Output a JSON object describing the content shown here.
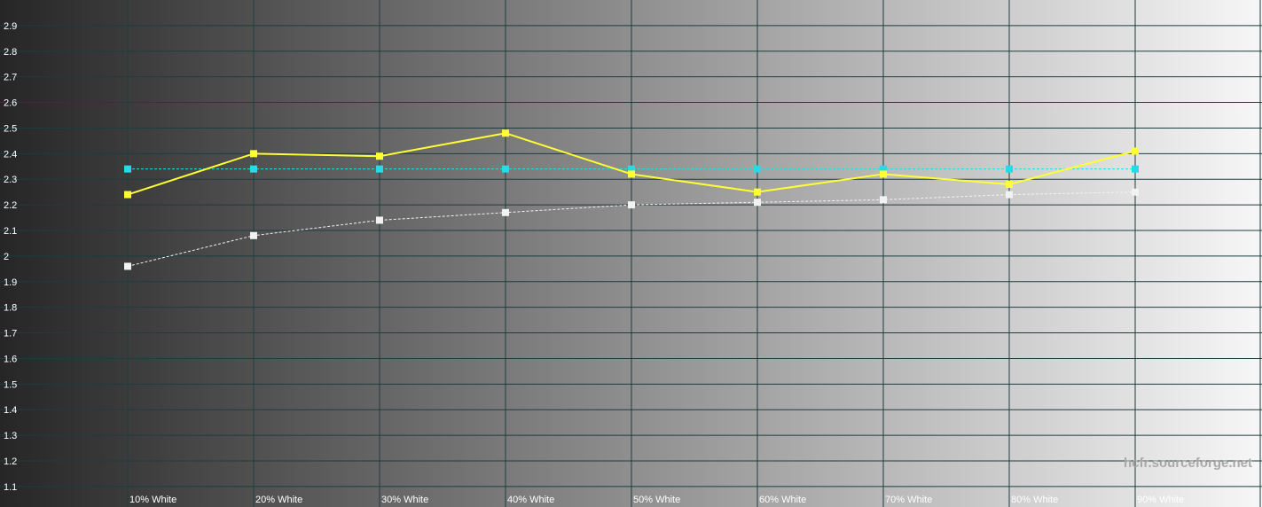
{
  "chart_data": {
    "type": "line",
    "categories": [
      "10% White",
      "20% White",
      "30% White",
      "40% White",
      "50% White",
      "60% White",
      "70% White",
      "80% White",
      "90% White"
    ],
    "y_ticks": [
      "1.1",
      "1.2",
      "1.3",
      "1.4",
      "1.5",
      "1.6",
      "1.7",
      "1.8",
      "1.9",
      "2",
      "2.1",
      "2.2",
      "2.3",
      "2.4",
      "2.5",
      "2.6",
      "2.7",
      "2.8",
      "2.9"
    ],
    "ylim": [
      1.02,
      3.0
    ],
    "grid": true,
    "series": [
      {
        "values": [
          2.24,
          2.4,
          2.39,
          2.48,
          2.32,
          2.25,
          2.32,
          2.28,
          2.41
        ],
        "color": "#ffff33",
        "style": "solid",
        "marker": "square"
      },
      {
        "values": [
          2.34,
          2.34,
          2.34,
          2.34,
          2.34,
          2.34,
          2.34,
          2.34,
          2.34
        ],
        "color": "#22dde6",
        "style": "dashed",
        "marker": "square"
      },
      {
        "values": [
          1.96,
          2.08,
          2.14,
          2.17,
          2.2,
          2.21,
          2.22,
          2.24,
          2.25
        ],
        "color": "#f2f2f2",
        "style": "dashed",
        "marker": "square"
      }
    ]
  },
  "watermark": "hcfr.sourceforge.net",
  "colors": {
    "grid": "#1e3d3d",
    "background_dark": "#262626",
    "background_light": "#f7f7f7",
    "tick_text": "#ffffff",
    "watermark": "#a8a8a8"
  }
}
